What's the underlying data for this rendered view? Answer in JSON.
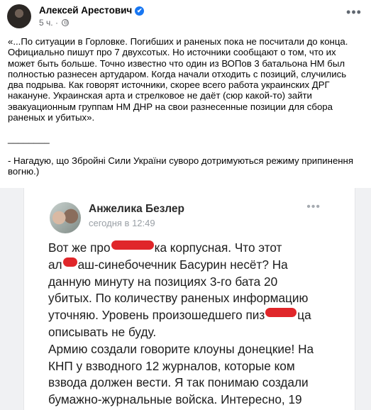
{
  "post": {
    "author": "Алексей Арестович",
    "time": "5 ч.",
    "meta_separator": "·",
    "more_label": "•••",
    "verified_mark": "✔",
    "paragraph1": [
      "«...По ситуации в Горловке. Погибших и раненых пока не посчитали до конца.",
      "Официально пишут про 7 двухсотых. Но источники сообщают о том, что их",
      "может быть больше. Точно известно что один из ВОПов  3 батальона НМ был",
      "полностью разнесен артударом. Когда начали отходить с позиций, случились",
      "два подрыва. Как говорят источники, скорее всего работа украинских ДРГ",
      "накануне. Украинская арта и стрелковое не даёт (сюр какой-то) зайти",
      "эвакуационным группам НМ ДНР на свои разнесенные позиции для сбора",
      "раненых и убитых»."
    ],
    "divider": "________",
    "paragraph2": [
      "- Нагадую, що Збройні Сили України суворо дотримуються режиму припинення",
      "вогню.)"
    ]
  },
  "embedded": {
    "name": "Анжелика Безлер",
    "time": "сегодня в 12:49",
    "more_label": "•••",
    "lines": [
      {
        "a": "Вот же про",
        "b": "ка корпусная. Что этот"
      },
      {
        "a": "ал",
        "b": "аш-синебочечник Басурин несёт? На"
      },
      {
        "a": "данную минуту на позициях 3-го бата 20",
        "b": ""
      },
      {
        "a": "убитых. По количеству раненых информацию",
        "b": ""
      },
      {
        "a": "уточняю. Уровень произошедшего пиз",
        "b": "ца"
      },
      {
        "a": "описывать не буду.",
        "b": ""
      },
      {
        "a": "Армию создали говорите клоуны донецкие! На",
        "b": ""
      },
      {
        "a": "КНП у взводного 12 журналов, которые ком",
        "b": ""
      },
      {
        "a": "взвода должен вести. Я так понимаю создали",
        "b": ""
      },
      {
        "a": "бумажно-журнальные войска. Интересно, 19",
        "b": ""
      }
    ],
    "redaction_color": "#e0262a"
  },
  "colors": {
    "accent": "#1877f2",
    "secondary_text": "#65676b",
    "embed_background": "#f0f1f3"
  }
}
